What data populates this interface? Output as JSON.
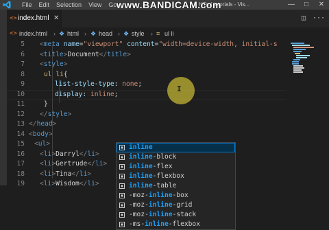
{
  "app": {
    "menu": [
      "File",
      "Edit",
      "Selection",
      "View",
      "Go"
    ],
    "window_title": "HTml tutorials - Vis...",
    "watermark": "www.BANDICAM.com",
    "accent_color": "#007acc"
  },
  "tab": {
    "label": "index.html",
    "file_icon": "html-icon",
    "close_icon": "close-icon"
  },
  "breadcrumb": {
    "items": [
      "index.html",
      "html",
      "head",
      "style",
      "ul li"
    ]
  },
  "editor": {
    "lines": [
      {
        "num": "5",
        "segments": [
          {
            "cls": "t",
            "text": "<"
          },
          {
            "cls": "tg",
            "text": "meta"
          },
          {
            "cls": "tx",
            "text": " "
          },
          {
            "cls": "at",
            "text": "name"
          },
          {
            "cls": "tx",
            "text": "="
          },
          {
            "cls": "st",
            "text": "\"viewport\""
          },
          {
            "cls": "tx",
            "text": " "
          },
          {
            "cls": "at",
            "text": "content"
          },
          {
            "cls": "tx",
            "text": "="
          },
          {
            "cls": "st",
            "text": "\"width=device-width, initial-s"
          }
        ]
      },
      {
        "num": "6",
        "segments": [
          {
            "cls": "t",
            "text": "<"
          },
          {
            "cls": "tg",
            "text": "title"
          },
          {
            "cls": "t",
            "text": ">"
          },
          {
            "cls": "tx",
            "text": "Document"
          },
          {
            "cls": "t",
            "text": "</"
          },
          {
            "cls": "tg",
            "text": "title"
          },
          {
            "cls": "t",
            "text": ">"
          }
        ]
      },
      {
        "num": "7",
        "segments": [
          {
            "cls": "t",
            "text": "<"
          },
          {
            "cls": "tg",
            "text": "style"
          },
          {
            "cls": "t",
            "text": ">"
          }
        ]
      },
      {
        "num": "8",
        "segments": [
          {
            "cls": "sel",
            "text": "ul li"
          },
          {
            "cls": "tx",
            "text": "{"
          }
        ]
      },
      {
        "num": "9",
        "segments": [
          {
            "cls": "pr",
            "text": "list-style-type"
          },
          {
            "cls": "tx",
            "text": ": "
          },
          {
            "cls": "vl",
            "text": "none"
          },
          {
            "cls": "tx",
            "text": ";"
          }
        ]
      },
      {
        "num": "10",
        "segments": [
          {
            "cls": "pr",
            "text": "display"
          },
          {
            "cls": "tx",
            "text": ": "
          },
          {
            "cls": "vl",
            "text": "inline"
          },
          {
            "cls": "tx",
            "text": ";"
          }
        ]
      },
      {
        "num": "11",
        "segments": [
          {
            "cls": "tx",
            "text": "}"
          }
        ]
      },
      {
        "num": "12",
        "segments": [
          {
            "cls": "t",
            "text": "</"
          },
          {
            "cls": "tg",
            "text": "style"
          },
          {
            "cls": "t",
            "text": ">"
          }
        ]
      },
      {
        "num": "13",
        "segments": [
          {
            "cls": "t",
            "text": "</"
          },
          {
            "cls": "tg",
            "text": "head"
          },
          {
            "cls": "t",
            "text": ">"
          }
        ]
      },
      {
        "num": "14",
        "segments": [
          {
            "cls": "t",
            "text": "<"
          },
          {
            "cls": "tg",
            "text": "body"
          },
          {
            "cls": "t",
            "text": ">"
          }
        ]
      },
      {
        "num": "15",
        "segments": [
          {
            "cls": "t",
            "text": "<"
          },
          {
            "cls": "tg",
            "text": "ul"
          },
          {
            "cls": "t",
            "text": ">"
          }
        ]
      },
      {
        "num": "16",
        "segments": [
          {
            "cls": "t",
            "text": "<"
          },
          {
            "cls": "tg",
            "text": "li"
          },
          {
            "cls": "t",
            "text": ">"
          },
          {
            "cls": "tx",
            "text": "Darryl"
          },
          {
            "cls": "t",
            "text": "</"
          },
          {
            "cls": "tg",
            "text": "li"
          },
          {
            "cls": "t",
            "text": ">"
          }
        ]
      },
      {
        "num": "17",
        "segments": [
          {
            "cls": "t",
            "text": "<"
          },
          {
            "cls": "tg",
            "text": "li"
          },
          {
            "cls": "t",
            "text": ">"
          },
          {
            "cls": "tx",
            "text": "Gertrude"
          },
          {
            "cls": "t",
            "text": "</"
          },
          {
            "cls": "tg",
            "text": "li"
          },
          {
            "cls": "t",
            "text": ">"
          }
        ]
      },
      {
        "num": "18",
        "segments": [
          {
            "cls": "t",
            "text": "<"
          },
          {
            "cls": "tg",
            "text": "li"
          },
          {
            "cls": "t",
            "text": ">"
          },
          {
            "cls": "tx",
            "text": "Tina"
          },
          {
            "cls": "t",
            "text": "</"
          },
          {
            "cls": "tg",
            "text": "li"
          },
          {
            "cls": "t",
            "text": ">"
          }
        ]
      },
      {
        "num": "19",
        "segments": [
          {
            "cls": "t",
            "text": "<"
          },
          {
            "cls": "tg",
            "text": "li"
          },
          {
            "cls": "t",
            "text": ">"
          },
          {
            "cls": "tx",
            "text": "Wisdom"
          },
          {
            "cls": "t",
            "text": "</"
          },
          {
            "cls": "tg",
            "text": "li"
          },
          {
            "cls": "t",
            "text": ">"
          }
        ]
      }
    ]
  },
  "suggest": {
    "items": [
      {
        "prefix": "",
        "match": "inline",
        "suffix": "",
        "active": true
      },
      {
        "prefix": "",
        "match": "inline",
        "suffix": "-block",
        "active": false
      },
      {
        "prefix": "",
        "match": "inline",
        "suffix": "-flex",
        "active": false
      },
      {
        "prefix": "",
        "match": "inline",
        "suffix": "-flexbox",
        "active": false
      },
      {
        "prefix": "",
        "match": "inline",
        "suffix": "-table",
        "active": false
      },
      {
        "prefix": "-moz-",
        "match": "inline",
        "suffix": "-box",
        "active": false
      },
      {
        "prefix": "-moz-",
        "match": "inline",
        "suffix": "-grid",
        "active": false
      },
      {
        "prefix": "-moz-",
        "match": "inline",
        "suffix": "-stack",
        "active": false
      },
      {
        "prefix": "-ms-",
        "match": "inline",
        "suffix": "-flexbox",
        "active": false
      }
    ]
  }
}
